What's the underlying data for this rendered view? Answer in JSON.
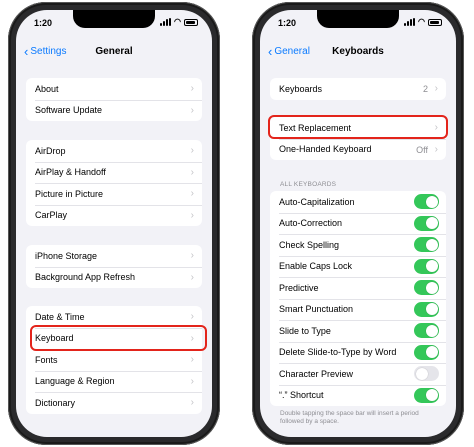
{
  "colors": {
    "accent": "#0a7aff",
    "toggle_on": "#34c759",
    "highlight": "#e3241b"
  },
  "left": {
    "status_time": "1:20",
    "back_label": "Settings",
    "title": "General",
    "groups": [
      [
        "About",
        "Software Update"
      ],
      [
        "AirDrop",
        "AirPlay & Handoff",
        "Picture in Picture",
        "CarPlay"
      ],
      [
        "iPhone Storage",
        "Background App Refresh"
      ],
      [
        "Date & Time",
        "Keyboard",
        "Fonts",
        "Language & Region",
        "Dictionary"
      ]
    ],
    "highlighted_item": "Keyboard"
  },
  "right": {
    "status_time": "1:20",
    "back_label": "General",
    "title": "Keyboards",
    "keyboards": {
      "label": "Keyboards",
      "value": "2"
    },
    "text_replacement": "Text Replacement",
    "one_handed": {
      "label": "One-Handed Keyboard",
      "value": "Off"
    },
    "section_header": "ALL KEYBOARDS",
    "toggles": [
      {
        "label": "Auto-Capitalization",
        "on": true
      },
      {
        "label": "Auto-Correction",
        "on": true
      },
      {
        "label": "Check Spelling",
        "on": true
      },
      {
        "label": "Enable Caps Lock",
        "on": true
      },
      {
        "label": "Predictive",
        "on": true
      },
      {
        "label": "Smart Punctuation",
        "on": true
      },
      {
        "label": "Slide to Type",
        "on": true
      },
      {
        "label": "Delete Slide-to-Type by Word",
        "on": true
      },
      {
        "label": "Character Preview",
        "on": false
      },
      {
        "label": "“.” Shortcut",
        "on": true
      }
    ],
    "footnote": "Double tapping the space bar will insert a period followed by a space."
  }
}
